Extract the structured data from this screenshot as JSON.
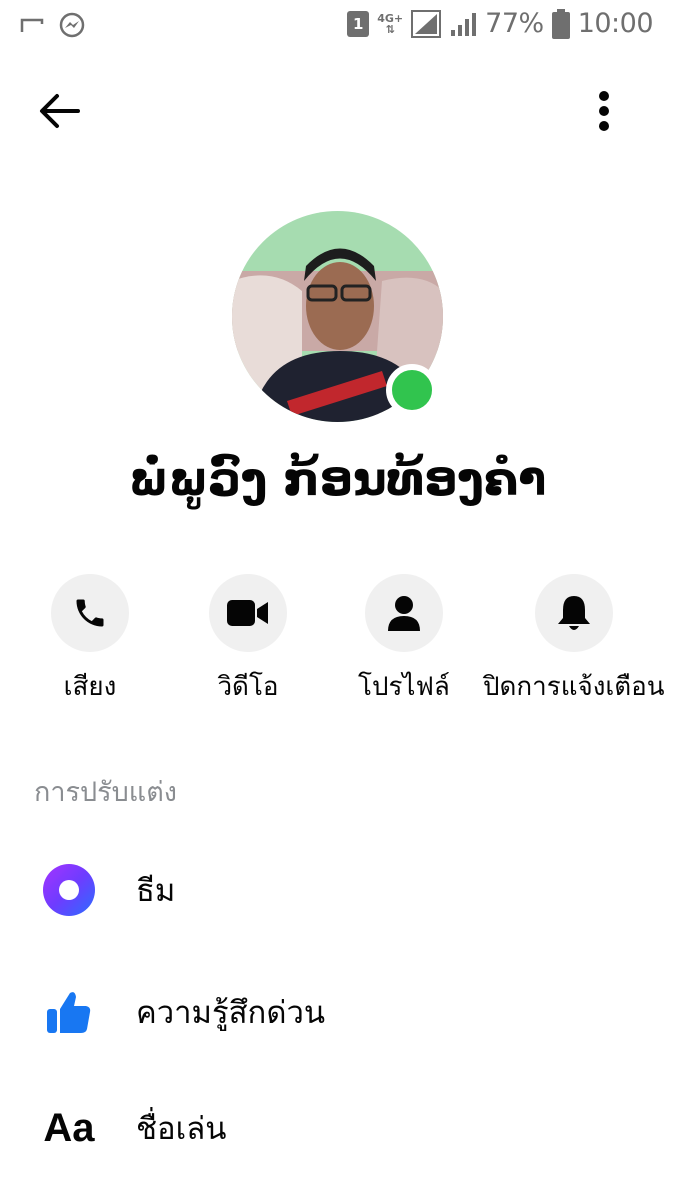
{
  "status_bar": {
    "sim_badge": "1",
    "network_type": "4G+",
    "battery_percent": "77%",
    "time": "10:00"
  },
  "header": {
    "back_icon": "arrow-left-icon",
    "more_icon": "vertical-dots-icon"
  },
  "profile": {
    "name": "ພໍ່ພູວົງ ກ້ອນທ້ອງຄໍາ",
    "online": true,
    "presence_color": "#31c44e"
  },
  "actions": [
    {
      "label": "เสียง",
      "icon": "phone-icon"
    },
    {
      "label": "วิดีโอ",
      "icon": "video-camera-icon"
    },
    {
      "label": "โปรไฟล์",
      "icon": "person-icon"
    },
    {
      "label": "ปิดการแจ้งเตือน",
      "icon": "bell-icon"
    }
  ],
  "customization": {
    "section_title": "การปรับแต่ง",
    "items": [
      {
        "label": "ธีม",
        "icon": "theme-icon"
      },
      {
        "label": "ความรู้สึกด่วน",
        "icon": "thumbs-up-icon"
      },
      {
        "label": "ชื่อเล่น",
        "icon": "nickname-icon",
        "icon_text": "Aa"
      }
    ]
  },
  "colors": {
    "accent": "#1877f2",
    "action_bg": "#f0f0f0",
    "secondary_text": "#8a8d91"
  }
}
